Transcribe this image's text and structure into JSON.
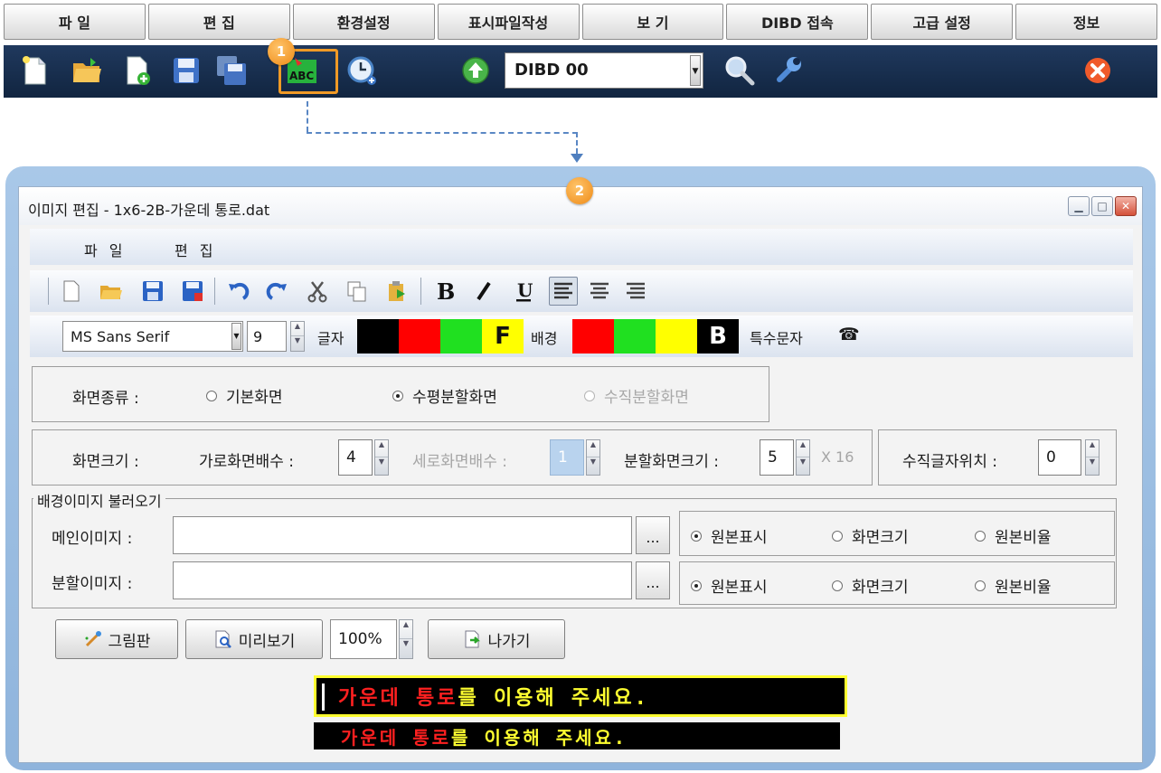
{
  "menu": [
    "파  일",
    "편  집",
    "환경설정",
    "표시파일작성",
    "보  기",
    "DIBD 접속",
    "고급 설정",
    "정보"
  ],
  "toolbar": {
    "device_value": "DIBD 00"
  },
  "callouts": [
    "1",
    "2"
  ],
  "colors": {
    "accent": "#f09a26",
    "toolbar_bg": "#14294a",
    "frame": "#9ec0e4",
    "dash": "#5a87c4"
  },
  "dialog": {
    "title": "이미지 편집 - 1x6-2B-가운데 통로.dat",
    "menu": [
      "파 일",
      "편 집"
    ],
    "font": {
      "name": "MS Sans Serif",
      "size": "9",
      "text_label": "글자",
      "text_letter": "F",
      "bg_label": "배경",
      "bg_letter": "B",
      "special_label": "특수문자",
      "special_glyph": "☎"
    },
    "text_swatches": [
      "#000000",
      "#ff0000",
      "#20e020",
      "#ffff00"
    ],
    "bg_swatches": [
      "#ff0000",
      "#20e020",
      "#ffff00",
      "#000000"
    ],
    "screen_type": {
      "label": "화면종류 :",
      "options": [
        "기본화면",
        "수평분할화면",
        "수직분할화면"
      ],
      "selected": 1,
      "disabled": 2
    },
    "screen_size": {
      "label": "화면크기 :",
      "h_label": "가로화면배수 :",
      "h_value": "4",
      "v_label": "세로화면배수 :",
      "v_value": "1",
      "split_label": "분할화면크기 :",
      "split_value": "5",
      "split_unit": "X 16",
      "vpos_label": "수직글자위치 :",
      "vpos_value": "0"
    },
    "bg_image": {
      "legend": "배경이미지 불러오기",
      "main_label": "메인이미지 :",
      "split_label": "분할이미지 :",
      "browse": "...",
      "options": [
        "원본표시",
        "화면크기",
        "원본비율"
      ]
    },
    "buttons": {
      "paint": "그림판",
      "preview": "미리보기",
      "zoom": "100%",
      "exit": "나가기"
    },
    "preview": {
      "part_red": "가운데 통로",
      "part_yellow": "를 이용해 주세요."
    }
  }
}
